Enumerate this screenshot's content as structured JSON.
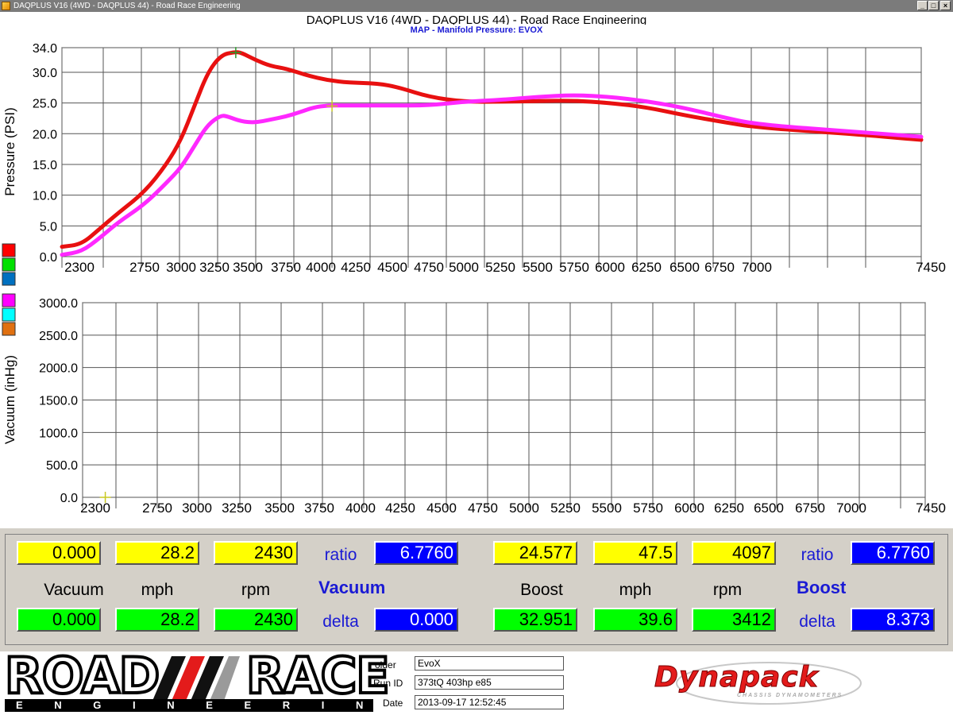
{
  "window": {
    "title": "DAQPLUS V16 (4WD - DAQPLUS 44) - Road Race Engineering",
    "controls": [
      "_",
      "□",
      "×"
    ]
  },
  "chart_header": {
    "title": "DAQPLUS V16 (4WD - DAQPLUS 44) - Road Race Engineering",
    "subtitle": "MAP - Manifold Pressure: EVOX"
  },
  "colors": {
    "red_series": "#e81010",
    "magenta_series": "#ff28ff",
    "swatches_top": [
      "#ff0000",
      "#00e000",
      "#0070c0"
    ],
    "swatches_bottom": [
      "#ff00ff",
      "#00ffff",
      "#e07010"
    ]
  },
  "chart_data": [
    {
      "type": "line",
      "ylabel": "Pressure (PSI)",
      "ytick_labels": [
        "34.0",
        "30.0",
        "25.0",
        "20.0",
        "15.0",
        "10.0",
        "5.0",
        "0.0"
      ],
      "yticks": [
        34,
        30,
        25,
        20,
        15,
        10,
        5,
        0
      ],
      "ylim": [
        0,
        34
      ],
      "xtick_labels": [
        "2300",
        "2750",
        "3000",
        "3250",
        "3500",
        "3750",
        "4000",
        "4250",
        "4500",
        "4750",
        "5000",
        "5250",
        "5500",
        "5750",
        "6000",
        "6250",
        "6500",
        "6750",
        "7000",
        "7450"
      ],
      "xticks": [
        2300,
        2750,
        3000,
        3250,
        3500,
        3750,
        4000,
        4250,
        4500,
        4750,
        5000,
        5250,
        5500,
        5750,
        6000,
        6250,
        6500,
        6750,
        7000,
        7450
      ],
      "xlim": [
        2300,
        7450
      ],
      "grid": true,
      "series": [
        {
          "color_key": "red_series",
          "x": [
            2300,
            2400,
            2500,
            2600,
            2750,
            2900,
            3000,
            3100,
            3200,
            3300,
            3400,
            3450,
            3550,
            3650,
            3750,
            3900,
            4050,
            4200,
            4400,
            4550,
            4750,
            5000,
            5250,
            5500,
            5750,
            6000,
            6250,
            6500,
            6750,
            7000,
            7250,
            7450
          ],
          "y": [
            1.6,
            2.0,
            4.5,
            7.0,
            10.5,
            15.0,
            19.0,
            24.5,
            30.0,
            32.8,
            33.3,
            33.2,
            32.0,
            31.0,
            30.6,
            29.5,
            28.7,
            28.3,
            28.2,
            27.5,
            26.0,
            25.2,
            25.2,
            25.3,
            25.4,
            25.0,
            24.3,
            23.0,
            22.0,
            21.0,
            20.0,
            19.0
          ]
        },
        {
          "color_key": "magenta_series",
          "x": [
            2300,
            2400,
            2500,
            2600,
            2750,
            2900,
            3000,
            3100,
            3200,
            3300,
            3350,
            3450,
            3550,
            3650,
            3750,
            3850,
            3950,
            4050,
            4150,
            4300,
            4500,
            4750,
            5000,
            5250,
            5500,
            5750,
            6000,
            6250,
            6500,
            6750,
            7000,
            7250,
            7450
          ],
          "y": [
            0.3,
            0.8,
            3.0,
            5.5,
            8.5,
            12.0,
            14.5,
            18.0,
            21.5,
            23.0,
            22.8,
            22.0,
            21.8,
            22.3,
            22.8,
            23.5,
            24.3,
            24.6,
            24.6,
            24.6,
            24.6,
            24.6,
            25.2,
            25.5,
            26.0,
            26.3,
            26.0,
            25.3,
            24.2,
            22.8,
            21.5,
            20.4,
            19.5
          ]
        }
      ],
      "markers": [
        {
          "x": 3410,
          "y": 33.2,
          "color": "#2a9a2a"
        },
        {
          "x": 4080,
          "y": 24.5,
          "color": "#c8c820"
        }
      ]
    },
    {
      "type": "line",
      "ylabel": "Vacuum (inHg)",
      "ytick_labels": [
        "3000.0",
        "2500.0",
        "2000.0",
        "1500.0",
        "1000.0",
        "500.0",
        "0.0"
      ],
      "yticks": [
        3000,
        2500,
        2000,
        1500,
        1000,
        500,
        0
      ],
      "ylim": [
        0,
        3000
      ],
      "xtick_labels": [
        "2300",
        "2750",
        "3000",
        "3250",
        "3500",
        "3750",
        "4000",
        "4250",
        "4500",
        "4750",
        "5000",
        "5250",
        "5500",
        "5750",
        "6000",
        "6250",
        "6500",
        "6750",
        "7000",
        "7450"
      ],
      "xticks": [
        2300,
        2750,
        3000,
        3250,
        3500,
        3750,
        4000,
        4250,
        4500,
        4750,
        5000,
        5250,
        5500,
        5750,
        6000,
        6250,
        6500,
        6750,
        7000,
        7450
      ],
      "xlim": [
        2300,
        7450
      ],
      "grid": true,
      "series": [],
      "markers": [
        {
          "x": 2430,
          "y": 0,
          "color": "#c8c820"
        }
      ]
    }
  ],
  "readouts": {
    "left": {
      "top": [
        "0.000",
        "28.2",
        "2430"
      ],
      "labels": [
        "Vacuum",
        "mph",
        "rpm"
      ],
      "bottom": [
        "0.000",
        "28.2",
        "2430"
      ],
      "ratio_label": "ratio",
      "ratio_value": "6.7760",
      "mode_label": "Vacuum",
      "delta_label": "delta",
      "delta_value": "0.000"
    },
    "right": {
      "top": [
        "24.577",
        "47.5",
        "4097"
      ],
      "labels": [
        "Boost",
        "mph",
        "rpm"
      ],
      "bottom": [
        "32.951",
        "39.6",
        "3412"
      ],
      "ratio_label": "ratio",
      "ratio_value": "6.7760",
      "mode_label": "Boost",
      "delta_label": "delta",
      "delta_value": "8.373"
    }
  },
  "footer": {
    "logo_left": {
      "top": "ROAD",
      "right": "RACE",
      "bottom": "E N G I N E E R I N G"
    },
    "fields": [
      {
        "label": "older",
        "value": "EvoX"
      },
      {
        "label": "Run ID",
        "value": "373tQ 403hp e85"
      },
      {
        "label": "Date",
        "value": "2013-09-17 12:52:45"
      }
    ],
    "logo_right": {
      "main": "Dynapack",
      "sub": "CHASSIS DYNAMOMETERS"
    }
  }
}
